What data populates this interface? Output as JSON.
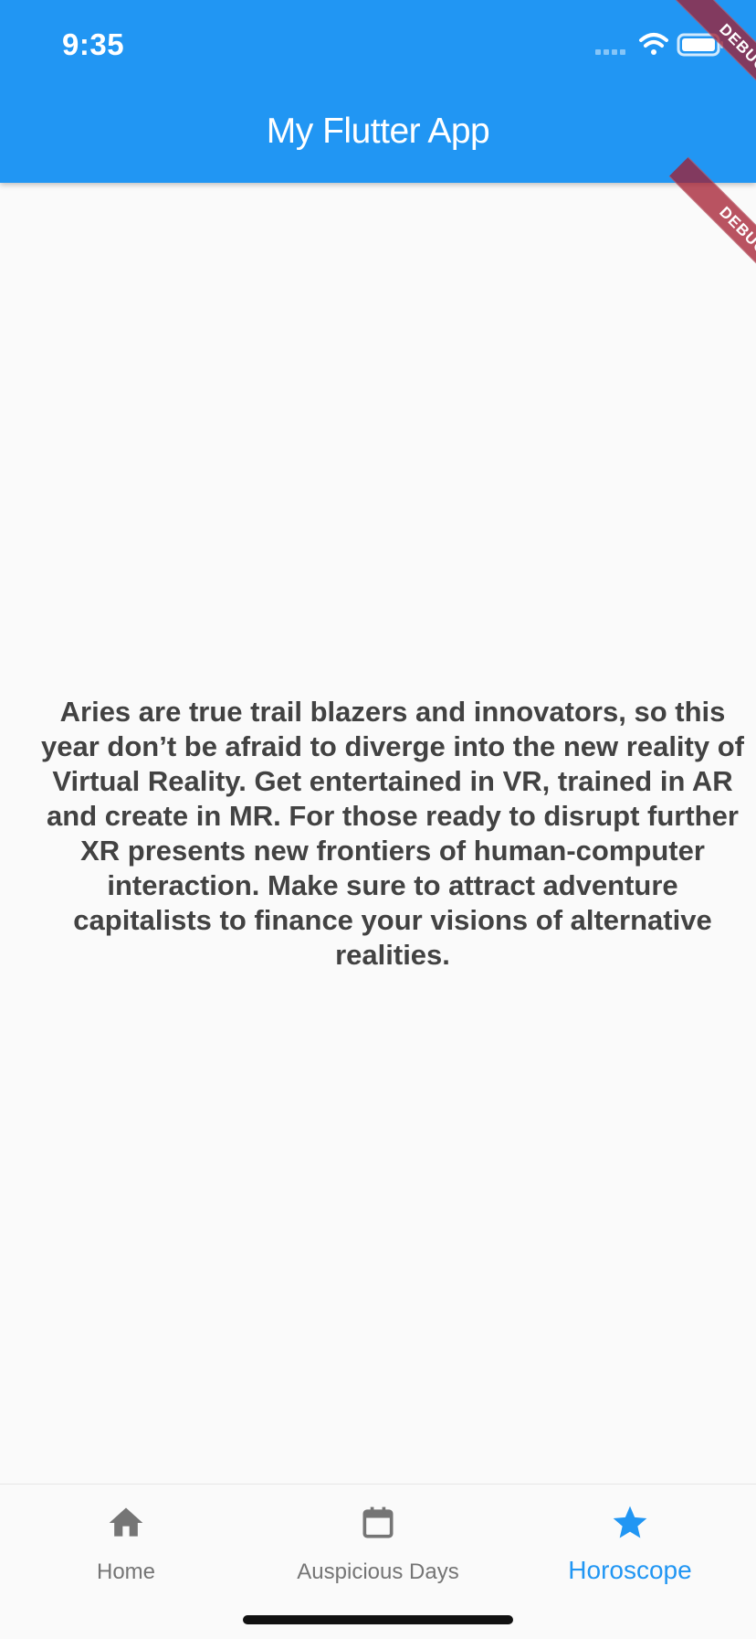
{
  "status_bar": {
    "time": "9:35",
    "icons": [
      "signal-icon",
      "wifi-icon",
      "battery-icon"
    ]
  },
  "app_bar": {
    "title": "My Flutter App"
  },
  "debug_banner": {
    "label": "DEBUG"
  },
  "content": {
    "horoscope_text": "Aries are true trail blazers and innovators, so this year don’t be afraid to diverge into the new reality of Virtual Reality. Get entertained in VR, trained in AR and create in MR. For those ready to disrupt further XR presents new frontiers of human-computer interaction. Make sure to attract adventure capitalists to finance your visions of alternative realities."
  },
  "bottom_nav": {
    "items": [
      {
        "label": "Home",
        "icon": "home-icon",
        "active": false
      },
      {
        "label": "Auspicious Days",
        "icon": "calendar-icon",
        "active": false
      },
      {
        "label": "Horoscope",
        "icon": "star-icon",
        "active": true
      }
    ]
  },
  "colors": {
    "primary": "#2196f3",
    "background": "#fafafa",
    "text": "#424242",
    "inactive": "#757575",
    "debug_banner": "#a31b2d"
  }
}
